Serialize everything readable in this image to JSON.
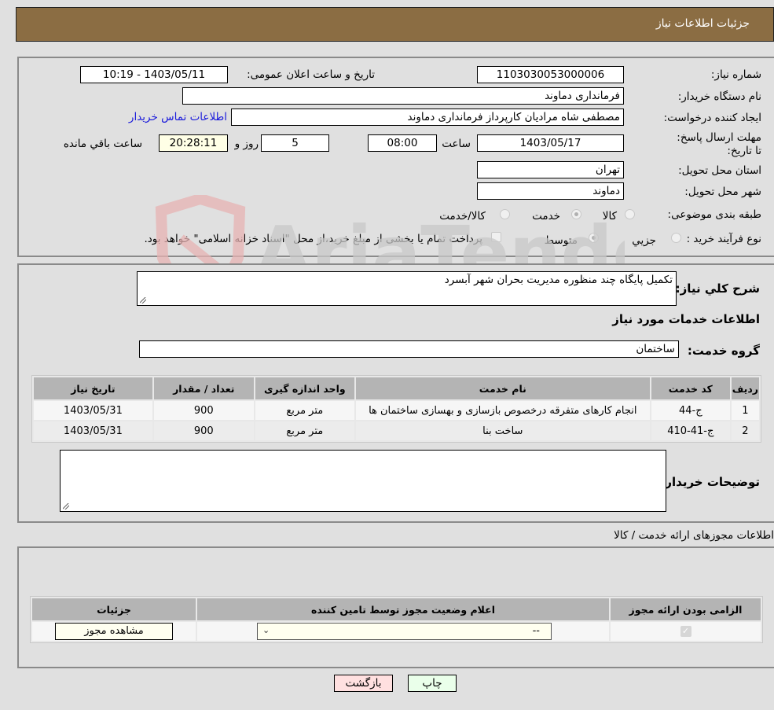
{
  "header": {
    "title": "جزئیات اطلاعات نیاز"
  },
  "details": {
    "need_number_label": "شماره نیاز:",
    "need_number": "1103030053000006",
    "announce_label": "تاریخ و ساعت اعلان عمومی:",
    "announce_value": "1403/05/11 - 10:19",
    "buyer_org_label": "نام دستگاه خریدار:",
    "buyer_org": "فرمانداری دماوند",
    "creator_label": "ایجاد کننده درخواست:",
    "creator": "مصطفی شاه مرادیان کارپرداز فرمانداری دماوند",
    "contact_link": "اطلاعات تماس خریدار",
    "deadline_label": "مهلت ارسال پاسخ: تا تاریخ:",
    "deadline_date": "1403/05/17",
    "time_label": "ساعت",
    "deadline_time": "08:00",
    "days_value": "5",
    "days_label": "روز و",
    "remaining_time": "20:28:11",
    "remaining_label": "ساعت باقي مانده",
    "province_label": "استان محل تحویل:",
    "province": "تهران",
    "city_label": "شهر محل تحویل:",
    "city": "دماوند",
    "category_label": "طبقه بندی موضوعی:",
    "category_options": [
      {
        "label": "کالا",
        "checked": false
      },
      {
        "label": "خدمت",
        "checked": true
      },
      {
        "label": "کالا/خدمت",
        "checked": false
      }
    ],
    "process_label": "نوع فرآیند خرید :",
    "process_options": [
      {
        "label": "جزيي",
        "checked": false
      },
      {
        "label": "متوسط",
        "checked": true
      }
    ],
    "treasury_note": "پرداخت تمام یا بخشی از مبلغ خرید،از محل \"اسناد خزانه اسلامی\" خواهد بود."
  },
  "needs": {
    "summary_label": "شرح كلي نياز:",
    "summary": "تکمیل پایگاه چند منظوره مدیریت بحران شهر آبسرد",
    "services_title": "اطلاعات خدمات مورد نياز",
    "service_group_label": "گروه خدمت:",
    "service_group": "ساختمان",
    "table": {
      "headers": [
        "ردیف",
        "کد خدمت",
        "نام خدمت",
        "واحد اندازه گیری",
        "تعداد / مقدار",
        "تاریخ نیاز"
      ],
      "rows": [
        [
          "1",
          "ج-44",
          "انجام کارهای متفرقه درخصوص بازسازی و بهسازی ساختمان ها",
          "متر مربع",
          "900",
          "1403/05/31"
        ],
        [
          "2",
          "ج-41-410",
          "ساخت بنا",
          "متر مربع",
          "900",
          "1403/05/31"
        ]
      ]
    },
    "buyer_notes_label": "توضیحات خریدار:",
    "buyer_notes": ""
  },
  "permits": {
    "title": "اطلاعات مجوزهای ارائه خدمت / کالا",
    "headers": [
      "الزامی بودن ارائه مجوز",
      "اعلام وضعیت مجوز توسط تامین کننده",
      "جزئیات"
    ],
    "row": {
      "required_checked": true,
      "status_selected": "--",
      "details_button": "مشاهده مجوز"
    }
  },
  "actions": {
    "print": "چاپ",
    "back": "بازگشت"
  },
  "watermark": {
    "text": "AriaTender.neT"
  },
  "colors": {
    "header": "#8b6d43",
    "link": "#1a1adb",
    "back_btn": "#ffe0e0",
    "print_btn": "#eaffea"
  }
}
